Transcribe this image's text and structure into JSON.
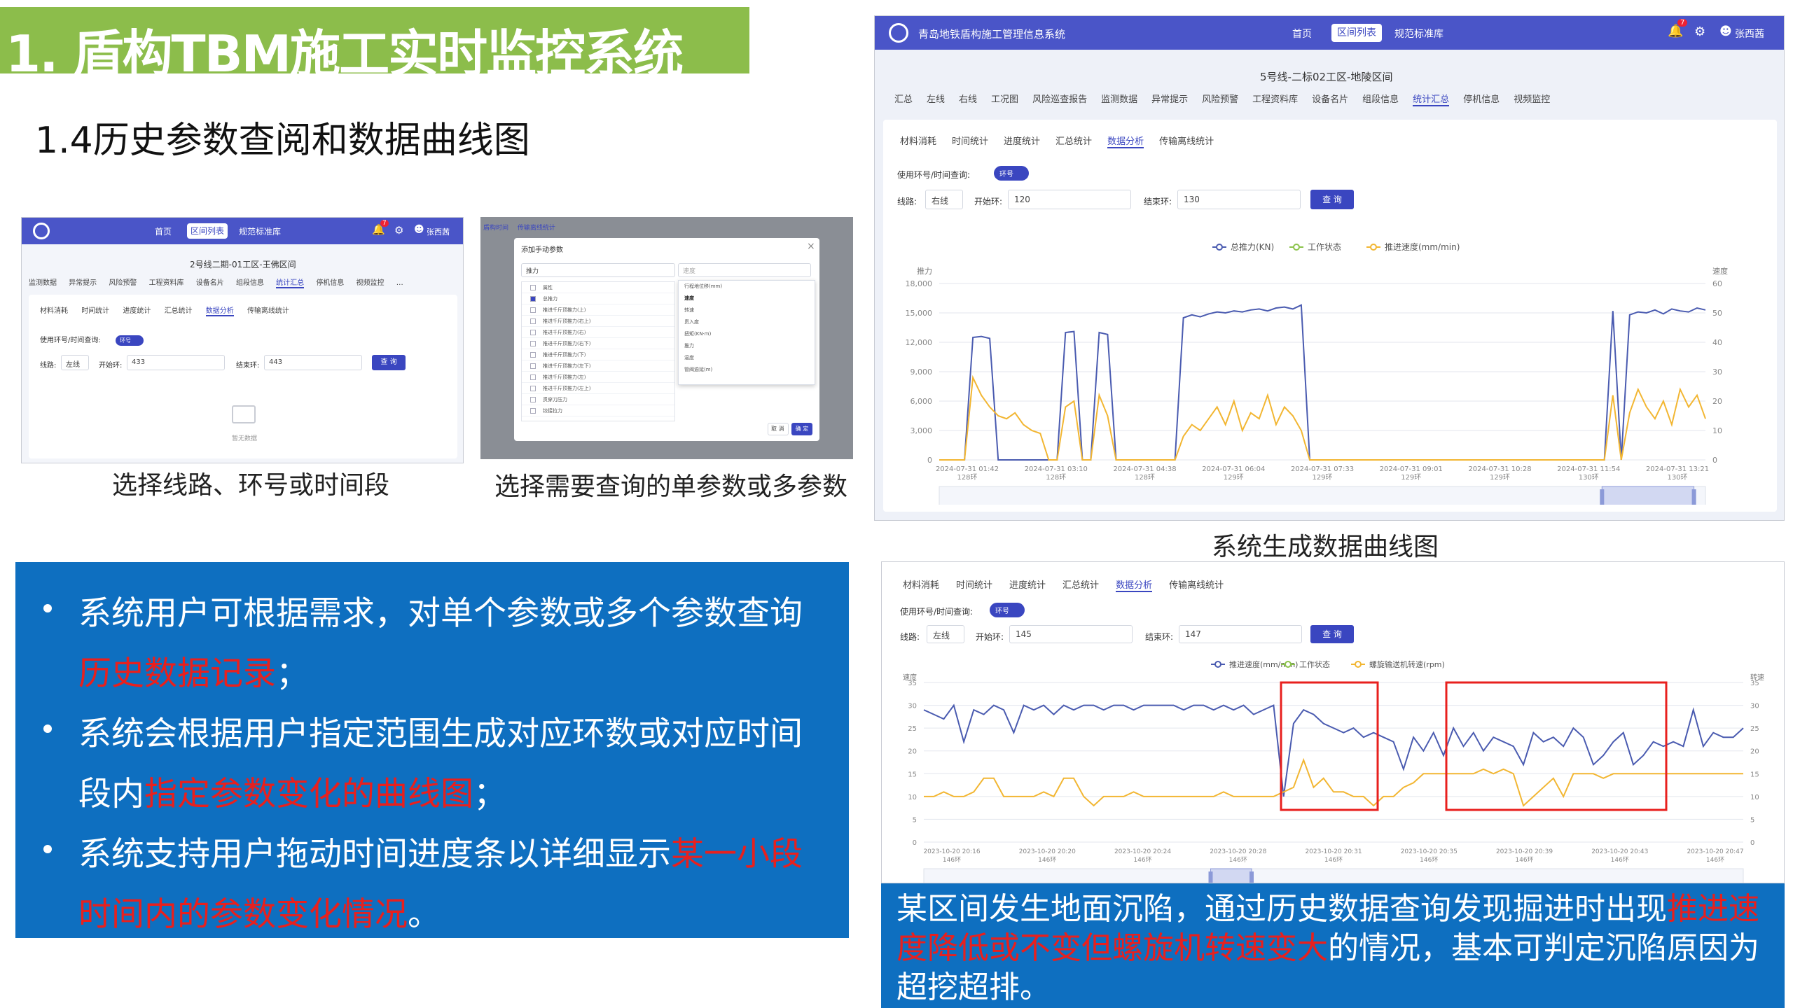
{
  "slide": {
    "title": "1. 盾构TBM施工实时监控系统",
    "subtitle": "1.4历史参数查阅和数据曲线图"
  },
  "shot1": {
    "app_nav": [
      "首页",
      "区间列表",
      "规范标准库"
    ],
    "user": "张西茜",
    "badge": "7",
    "section": "2号线二期-01工区-王佛区间",
    "tabs": [
      "监测数据",
      "异常提示",
      "风险预警",
      "工程资料库",
      "设备名片",
      "组段信息",
      "统计汇总",
      "停机信息",
      "视频监控",
      "…"
    ],
    "subtabs": [
      "材料消耗",
      "时间统计",
      "进度统计",
      "汇总统计",
      "数据分析",
      "传输离线统计"
    ],
    "query_label": "使用环号/时间查询:",
    "toggle_text": "环号",
    "line_label": "线路:",
    "line_value": "左线",
    "start_label": "开始环:",
    "start_value": "433",
    "end_label": "结束环:",
    "end_value": "443",
    "query_btn": "查 询",
    "empty_text": "暂无数据",
    "caption": "选择线路、环号或时间段"
  },
  "shot2": {
    "tabs": [
      "盾构时间",
      "传输离线统计"
    ],
    "dialog_title": "添加手动参数",
    "left_select": "推力",
    "right_select": "速度",
    "left_items": [
      "属性",
      "总推力",
      "推进千斤顶推力(上)",
      "推进千斤顶推力(右上)",
      "推进千斤顶推力(右)",
      "推进千斤顶推力(右下)",
      "推进千斤顶推力(下)",
      "推进千斤顶推力(左下)",
      "推进千斤顶推力(左)",
      "推进千斤顶推力(左上)",
      "贯穿刀压力",
      "铰接拉力"
    ],
    "right_items": [
      "行程地位移(mm)",
      "速度",
      "转速",
      "贯入度",
      "扭矩(KN·m)",
      "推力",
      "温度",
      "管阀逾延(m)"
    ],
    "cancel_btn": "取 消",
    "ok_btn": "确 定",
    "caption": "选择需要查询的单参数或多参数"
  },
  "shot3": {
    "app_name": "青岛地铁盾构施工管理信息系统",
    "app_nav": [
      "首页",
      "区间列表",
      "规范标准库"
    ],
    "user": "张西茜",
    "badge": "7",
    "section": "5号线-二标02工区-地陵区间",
    "tabs": [
      "汇总",
      "左线",
      "右线",
      "工况图",
      "风险巡查报告",
      "监测数据",
      "异常提示",
      "风险预警",
      "工程资料库",
      "设备名片",
      "组段信息",
      "统计汇总",
      "停机信息",
      "视频监控"
    ],
    "subtabs": [
      "材料消耗",
      "时间统计",
      "进度统计",
      "汇总统计",
      "数据分析",
      "传输离线统计"
    ],
    "query_label": "使用环号/时间查询:",
    "toggle_text": "环号",
    "line_label": "线路:",
    "line_value": "右线",
    "start_label": "开始环:",
    "start_value": "120",
    "end_label": "结束环:",
    "end_value": "130",
    "query_btn": "查 询",
    "caption": "系统生成数据曲线图"
  },
  "shot4": {
    "subtabs": [
      "材料消耗",
      "时间统计",
      "进度统计",
      "汇总统计",
      "数据分析",
      "传输离线统计"
    ],
    "query_label": "使用环号/时间查询:",
    "toggle_text": "环号",
    "line_label": "线路:",
    "line_value": "左线",
    "start_label": "开始环:",
    "start_value": "145",
    "end_label": "结束环:",
    "end_value": "147",
    "query_btn": "查 询"
  },
  "bullets": [
    {
      "parts": [
        "系统用户可根据需求，对单个参数或多个参数查询",
        "",
        ""
      ],
      "line2": [
        "",
        "历史数据记录",
        "；"
      ]
    },
    {
      "parts": [
        "系统会根据用户指定范围生成对应环数或对应时间",
        "",
        ""
      ],
      "line2": [
        "段内",
        "指定参数变化的曲线图",
        "；"
      ]
    },
    {
      "parts": [
        "系统支持用户拖动时间进度条以详细显示",
        "某一小段",
        ""
      ],
      "line2": [
        "",
        "时间内的参数变化情况",
        "。"
      ]
    }
  ],
  "case_text": {
    "l1a": "某区间发生地面沉陷，通过历史数据查询发现掘进时出现",
    "l1b": "推进速",
    "l2a": "度降低或不变但螺旋机转速变大",
    "l2b": "的情况，基本可判定沉陷原因为",
    "l3": "超挖超排。"
  },
  "colors": {
    "banner": "#8cbd4b",
    "blue_box": "#0e6fc0",
    "nav": "#4a55c8",
    "series_blue": "#4a5bb0",
    "series_green": "#8bc34a",
    "series_yellow": "#f2b632",
    "highlight_red": "#e8201e"
  },
  "chart_data": [
    {
      "type": "line",
      "legend": [
        "总推力(KN)",
        "工作状态",
        "推进速度(mm/min)"
      ],
      "ylabel_left": "推力",
      "ylabel_right": "速度",
      "yticks_left": [
        "0",
        "3,000",
        "6,000",
        "9,000",
        "12,000",
        "15,000",
        "18,000"
      ],
      "yticks_right": [
        "0",
        "10",
        "20",
        "30",
        "40",
        "50",
        "60"
      ],
      "ylim_left": [
        0,
        18000
      ],
      "ylim_right": [
        0,
        60
      ],
      "xticks": [
        [
          "2024-07-31 01:42",
          "128环"
        ],
        [
          "2024-07-31 03:10",
          "128环"
        ],
        [
          "2024-07-31 04:38",
          "128环"
        ],
        [
          "2024-07-31 06:04",
          "129环"
        ],
        [
          "2024-07-31 07:33",
          "129环"
        ],
        [
          "2024-07-31 09:01",
          "129环"
        ],
        [
          "2024-07-31 10:28",
          "129环"
        ],
        [
          "2024-07-31 11:54",
          "130环"
        ],
        [
          "2024-07-31 13:21",
          "130环"
        ]
      ],
      "series": [
        {
          "name": "总推力(KN)",
          "axis": "left",
          "values": [
            0,
            0,
            0,
            0,
            12500,
            12600,
            12400,
            0,
            0,
            0,
            0,
            0,
            0,
            0,
            0,
            13000,
            13100,
            0,
            0,
            13000,
            12800,
            0,
            0,
            0,
            0,
            0,
            0,
            0,
            0,
            14500,
            14800,
            14600,
            14900,
            15100,
            15000,
            15200,
            15100,
            15300,
            15400,
            15200,
            15500,
            15600,
            15400,
            15800,
            0,
            0,
            0,
            0,
            0,
            0,
            0,
            0,
            0,
            0,
            0,
            0,
            0,
            0,
            0,
            0,
            0,
            0,
            0,
            0,
            0,
            0,
            0,
            0,
            0,
            0,
            0,
            0,
            0,
            0,
            0,
            0,
            0,
            0,
            0,
            0,
            15200,
            0,
            14800,
            15100,
            15000,
            15300,
            14900,
            15400,
            15200,
            15100,
            15500,
            15300
          ]
        },
        {
          "name": "推进速度(mm/min)",
          "axis": "right",
          "values": [
            0,
            0,
            0,
            0,
            28,
            22,
            18,
            15,
            14,
            16,
            12,
            10,
            9,
            0,
            0,
            18,
            20,
            0,
            0,
            22,
            15,
            0,
            0,
            0,
            0,
            0,
            0,
            0,
            0,
            8,
            12,
            10,
            14,
            18,
            12,
            20,
            10,
            16,
            14,
            22,
            12,
            18,
            15,
            10,
            0,
            0,
            0,
            0,
            0,
            0,
            0,
            0,
            0,
            0,
            0,
            0,
            0,
            0,
            0,
            0,
            0,
            0,
            0,
            0,
            0,
            0,
            0,
            0,
            0,
            0,
            0,
            0,
            0,
            0,
            0,
            0,
            0,
            0,
            0,
            0,
            22,
            0,
            16,
            24,
            18,
            14,
            20,
            12,
            24,
            18,
            22,
            14
          ]
        }
      ]
    },
    {
      "type": "line",
      "legend": [
        "推进速度(mm/min)",
        "工作状态",
        "螺旋输送机转速(rpm)"
      ],
      "ylabel_left": "速度",
      "ylabel_right": "转速",
      "yticks_left": [
        "0",
        "5",
        "10",
        "15",
        "20",
        "25",
        "30",
        "35"
      ],
      "yticks_right": [
        "0",
        "5",
        "10",
        "15",
        "20",
        "25",
        "30",
        "35"
      ],
      "ylim_left": [
        0,
        35
      ],
      "ylim_right": [
        0,
        35
      ],
      "xticks": [
        [
          "2023-10-20 20:16",
          "146环"
        ],
        [
          "2023-10-20 20:20",
          "146环"
        ],
        [
          "2023-10-20 20:24",
          "146环"
        ],
        [
          "2023-10-20 20:28",
          "146环"
        ],
        [
          "2023-10-20 20:31",
          "146环"
        ],
        [
          "2023-10-20 20:35",
          "146环"
        ],
        [
          "2023-10-20 20:39",
          "146环"
        ],
        [
          "2023-10-20 20:43",
          "146环"
        ],
        [
          "2023-10-20 20:47",
          "146环"
        ]
      ],
      "series": [
        {
          "name": "推进速度(mm/min)",
          "axis": "left",
          "values": [
            29,
            28,
            27,
            30,
            22,
            29,
            28,
            30,
            29,
            24,
            30,
            29,
            30,
            28,
            30,
            29,
            30,
            30,
            29,
            30,
            30,
            29,
            30,
            30,
            30,
            30,
            29,
            30,
            30,
            29,
            30,
            29,
            30,
            28,
            29,
            30,
            10,
            26,
            29,
            28,
            26,
            25,
            24,
            25,
            23,
            24,
            23,
            22,
            16,
            23,
            20,
            24,
            19,
            25,
            21,
            24,
            20,
            23,
            22,
            21,
            17,
            24,
            22,
            23,
            21,
            25,
            23,
            17,
            19,
            22,
            24,
            17,
            19,
            22,
            21,
            22,
            21,
            29,
            21,
            24,
            23,
            23,
            25
          ]
        },
        {
          "name": "螺旋输送机转速(rpm)",
          "axis": "right",
          "values": [
            10,
            10,
            11,
            10,
            10,
            11,
            14,
            14,
            10,
            10,
            10,
            10,
            11,
            10,
            14,
            14,
            10,
            8,
            10,
            10,
            10,
            11,
            10,
            10,
            10,
            10,
            10,
            10,
            10,
            10,
            11,
            10,
            10,
            10,
            10,
            10,
            11,
            12,
            18,
            12,
            14,
            11,
            11,
            10,
            10,
            8,
            10,
            10,
            12,
            13,
            15,
            15,
            15,
            15,
            15,
            15,
            16,
            15,
            16,
            15,
            8,
            10,
            12,
            14,
            10,
            15,
            15,
            15,
            14,
            15,
            15,
            15,
            15,
            15,
            15,
            15,
            15,
            15,
            15,
            15,
            15,
            15,
            15
          ]
        }
      ]
    }
  ]
}
